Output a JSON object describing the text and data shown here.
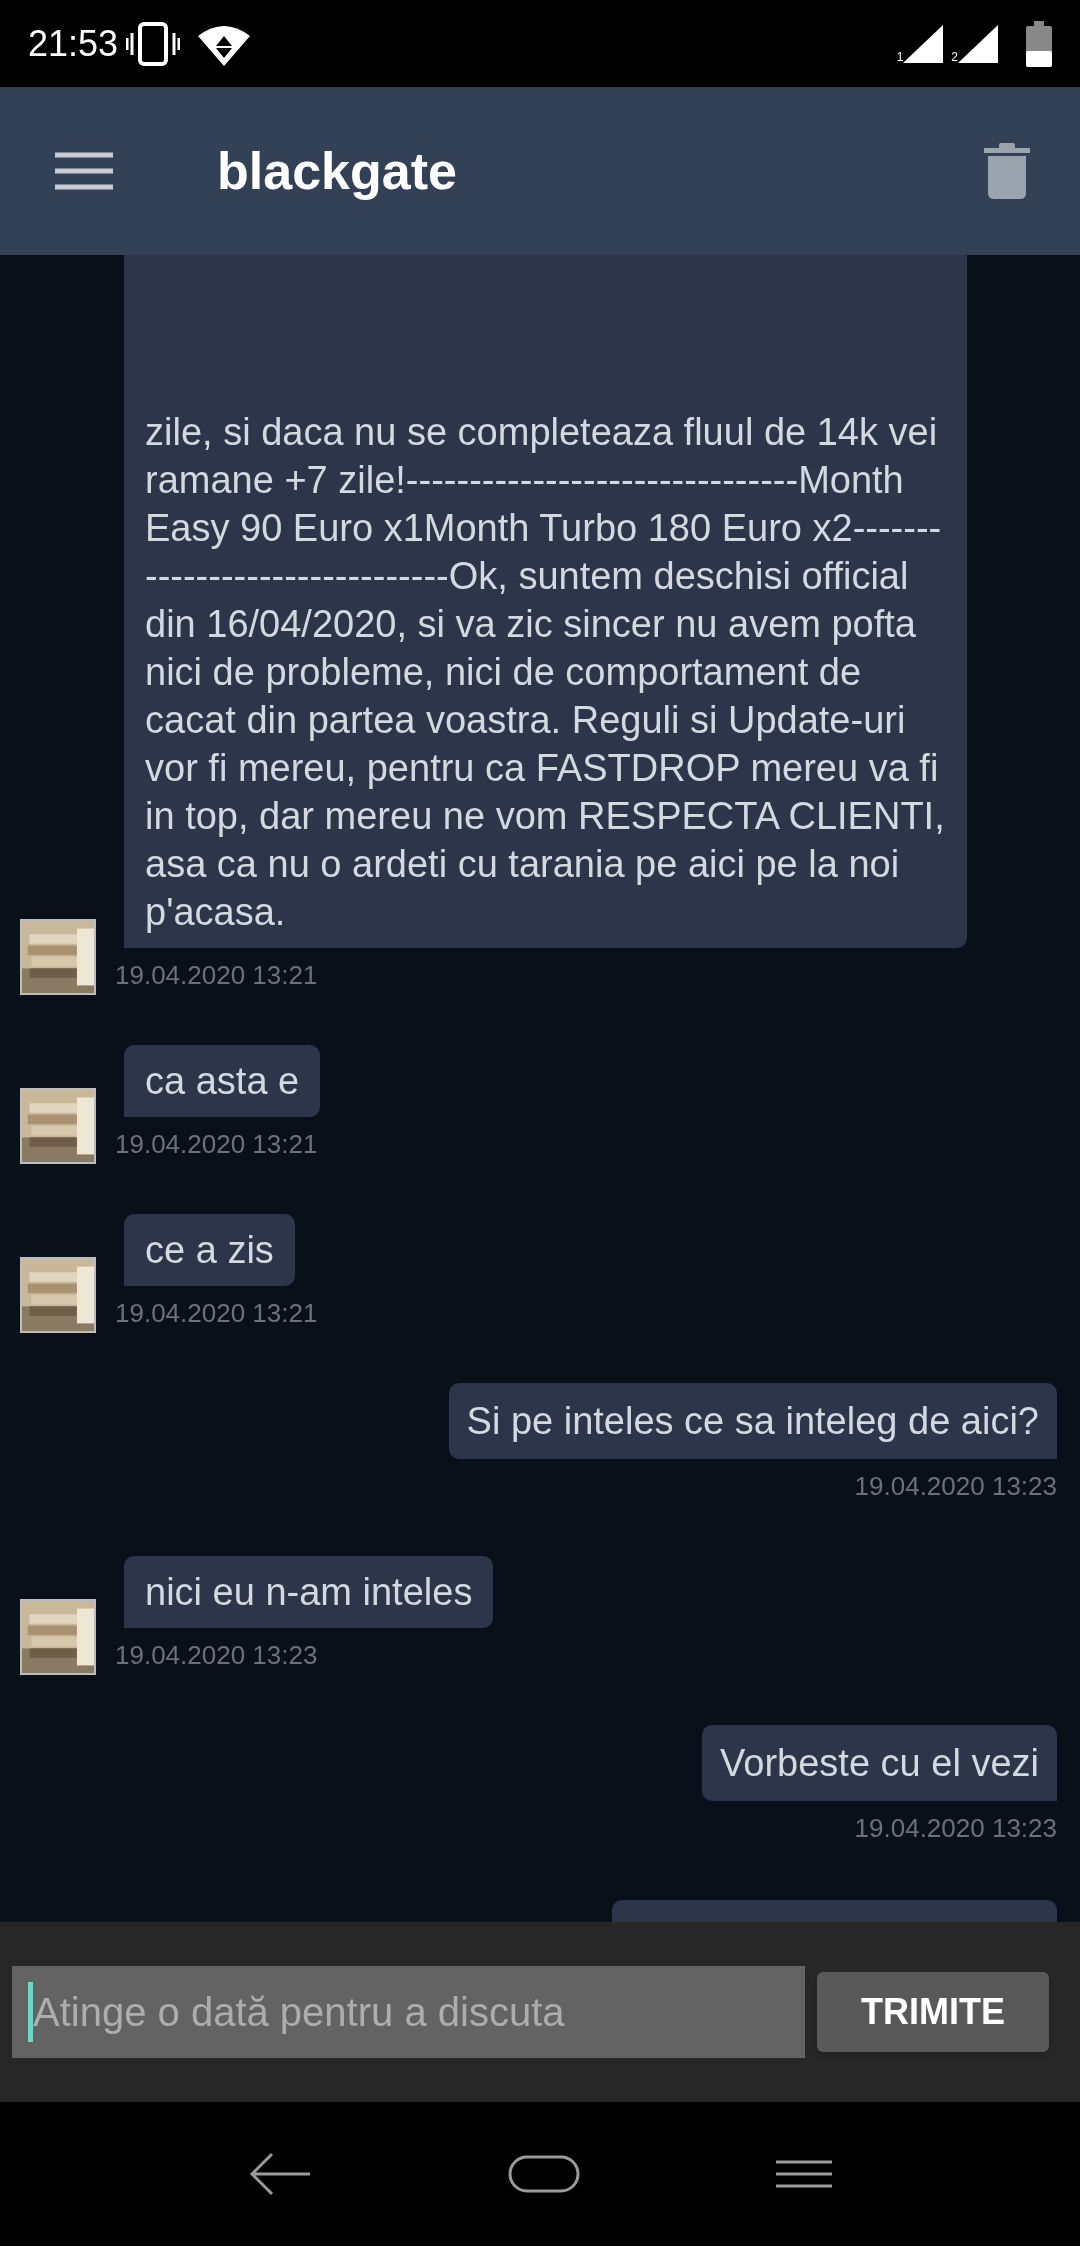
{
  "status_bar": {
    "time": "21:53",
    "sim_labels": [
      "1",
      "2"
    ]
  },
  "header": {
    "title": "blackgate"
  },
  "messages": [
    {
      "kind": "incoming",
      "text": "zile, si daca nu se completeaza fluul de 14k vei ramane +7 zile!-------------------------------Month Easy 90 Euro x1Month Turbo 180 Euro x2-------------------------------Ok, suntem deschisi official din 16/04/2020, si va zic sincer nu avem pofta nici de probleme, nici de comportament de cacat din partea voastra. Reguli si Update-uri vor fi mereu, pentru ca FASTDROP mereu va fi in top, dar mereu ne vom RESPECTA CLIENTI, asa ca nu o ardeti cu tarania pe aici pe la noi p'acasa.",
      "time": "19.04.2020 13:21"
    },
    {
      "kind": "incoming",
      "text": "ca asta e",
      "time": "19.04.2020 13:21"
    },
    {
      "kind": "incoming",
      "text": "ce a zis",
      "time": "19.04.2020 13:21"
    },
    {
      "kind": "outgoing",
      "text": "Si pe inteles ce sa inteleg de aici?",
      "time": "19.04.2020 13:23"
    },
    {
      "kind": "incoming",
      "text": "nici eu n-am inteles",
      "time": "19.04.2020 13:23"
    },
    {
      "kind": "outgoing",
      "text": "Vorbeste cu el vezi",
      "time": "19.04.2020 13:23"
    },
    {
      "kind": "outgoing_partial"
    }
  ],
  "composer": {
    "placeholder": "Atinge o dată pentru a discuta",
    "button": "TRIMITE"
  }
}
